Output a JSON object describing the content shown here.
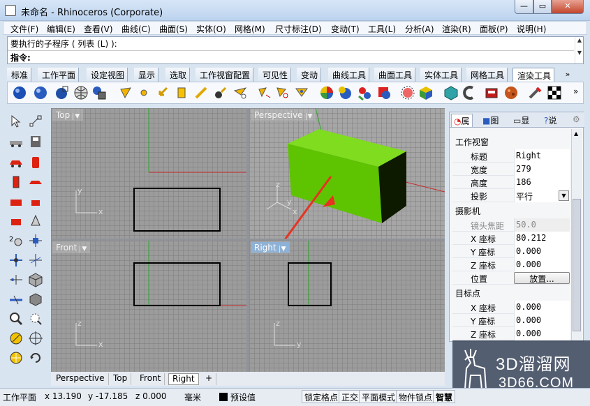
{
  "window": {
    "title": "未命名 - Rhinoceros (Corporate)",
    "min": "—",
    "max": "▭",
    "close": "✕"
  },
  "menu": [
    "文件(F)",
    "编辑(E)",
    "查看(V)",
    "曲线(C)",
    "曲面(S)",
    "实体(O)",
    "网格(M)",
    "尺寸标注(D)",
    "变动(T)",
    "工具(L)",
    "分析(A)",
    "渲染(R)",
    "面板(P)",
    "说明(H)"
  ],
  "command": {
    "history": "要执行的子程序 ( 列表 (L) ):",
    "prompt": "指令:",
    "value": ""
  },
  "tabs": [
    "标准",
    "工作平面",
    "设定视图",
    "显示",
    "选取",
    "工作视窗配置",
    "可见性",
    "变动",
    "曲线工具",
    "曲面工具",
    "实体工具",
    "网格工具",
    "渲染工具"
  ],
  "tabs_active": "渲染工具",
  "tabs_more": "»",
  "toolbar_icons": [
    "render-icon",
    "render-preview-icon",
    "render-region-icon",
    "render-globe-icon",
    "render-save-icon",
    "spotlight-icon",
    "point-light-icon",
    "directional-light-icon",
    "rectangle-light-icon",
    "linear-light-icon",
    "light-tool-icon",
    "light-edit-icon",
    "light-move-icon",
    "light-target-icon",
    "color-sphere-icon",
    "material-icon",
    "texture-map-icon",
    "material-library-icon",
    "decal-icon",
    "environment-icon",
    "ground-plane-icon",
    "render-mesh-icon",
    "sun-icon",
    "texture-ball-icon",
    "paint-icon",
    "checker-icon"
  ],
  "viewports": {
    "top": {
      "label": "Top",
      "axis_x": "x",
      "axis_y": "y"
    },
    "perspective": {
      "label": "Perspective",
      "axis_x": "x",
      "axis_y": "y",
      "axis_z": "z"
    },
    "front": {
      "label": "Front",
      "axis_x": "x",
      "axis_z": "z"
    },
    "right": {
      "label": "Right",
      "axis_y": "y",
      "axis_z": "z"
    },
    "box_color": "#5ec300",
    "active": "Right"
  },
  "viewport_tabs": [
    "Perspective",
    "Top",
    "Front",
    "Right",
    "+"
  ],
  "viewport_tabs_active": "Right",
  "panel": {
    "tabs": [
      "属",
      "图",
      "显",
      "说"
    ],
    "section_viewport": "工作视窗",
    "rows1": [
      {
        "label": "标题",
        "value": "Right"
      },
      {
        "label": "宽度",
        "value": "279"
      },
      {
        "label": "高度",
        "value": "186"
      },
      {
        "label": "投影",
        "value": "平行"
      }
    ],
    "section_camera": "摄影机",
    "rows2": [
      {
        "label": "镜头焦距",
        "value": "50.0"
      },
      {
        "label": "X 座标",
        "value": "80.212"
      },
      {
        "label": "Y 座标",
        "value": "0.000"
      },
      {
        "label": "Z 座标",
        "value": "0.000"
      },
      {
        "label": "位置",
        "value": "放置..."
      }
    ],
    "section_target": "目标点",
    "rows3": [
      {
        "label": "X 座标",
        "value": "0.000"
      },
      {
        "label": "Y 座标",
        "value": "0.000"
      },
      {
        "label": "Z 座标",
        "value": "0.000"
      }
    ]
  },
  "status": {
    "cplane": "工作平面",
    "x": "x 13.190",
    "y": "y -17.185",
    "z": "z 0.000",
    "unit": "毫米",
    "layer": "预设值",
    "grid_snap": "锁定格点",
    "ortho": "正交",
    "planar": "平面模式",
    "osnap": "物件锁点",
    "smart": "智慧"
  },
  "watermark": {
    "line1": "3D溜溜网",
    "line2": "3D66.COM"
  }
}
